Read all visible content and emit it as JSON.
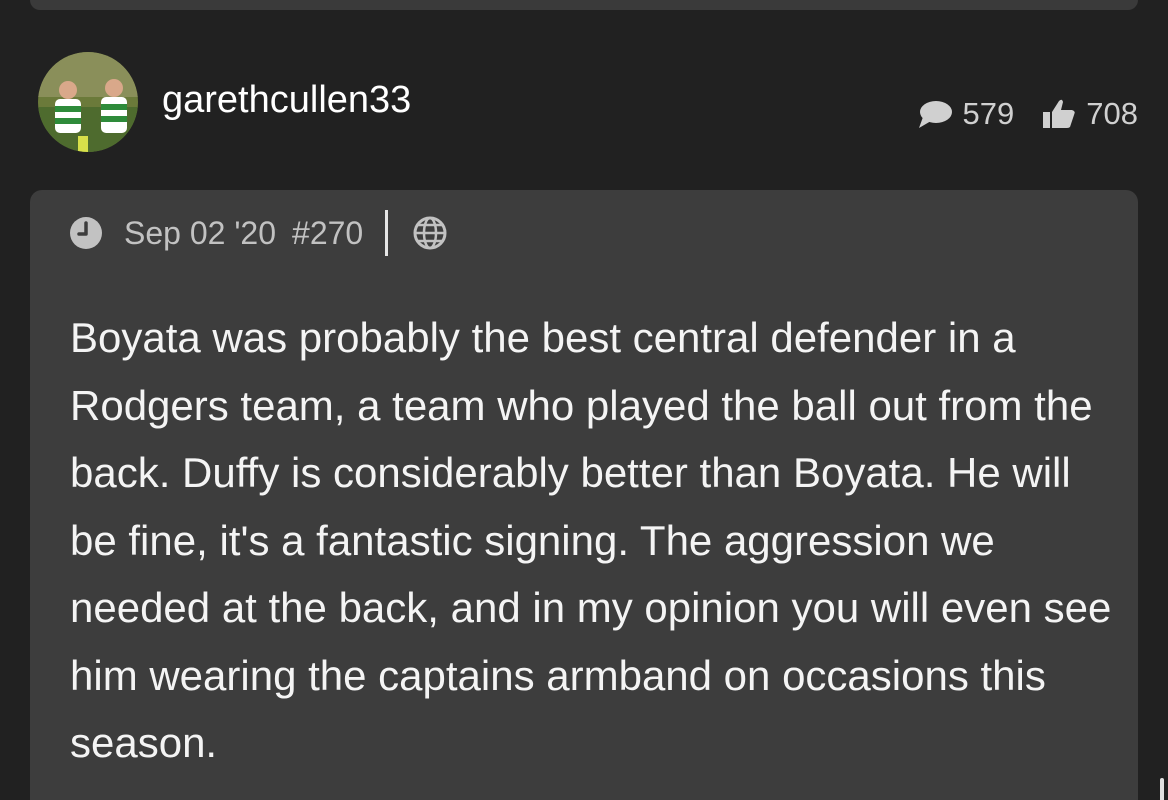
{
  "user": {
    "username": "garethcullen33",
    "avatar_icon": "avatar-photo",
    "comment_count": "579",
    "like_count": "708",
    "comment_icon": "speech-bubble-icon",
    "like_icon": "thumbs-up-icon"
  },
  "post": {
    "date": "Sep 02 '20",
    "number": "#270",
    "clock_icon": "clock-icon",
    "globe_icon": "globe-icon",
    "body": "Boyata was probably the best central defender in a Rodgers team, a team who played the ball out from the back. Duffy is considerably better than Boyata. He will be fine, it's a fantastic signing. The aggression we needed at the back, and in my opinion you will even see him wearing the captains armband on occasions this season."
  },
  "colors": {
    "background": "#212121",
    "card": "#3d3d3d",
    "meta_text": "#c2c2c2"
  }
}
